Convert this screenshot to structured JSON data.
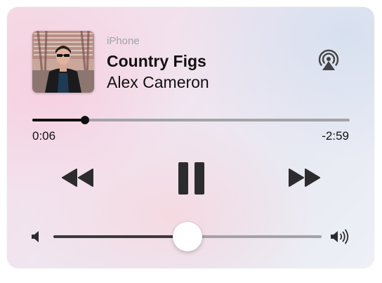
{
  "now_playing": {
    "source": "iPhone",
    "title": "Country Figs",
    "artist": "Alex Cameron",
    "artwork_icon": "album-artwork"
  },
  "playback": {
    "elapsed": "0:06",
    "remaining": "-2:59",
    "progress": 0.167
  },
  "controls": {
    "rewind_icon": "rewind-icon",
    "pause_icon": "pause-icon",
    "forward_icon": "fast-forward-icon",
    "airplay_icon": "airplay-icon"
  },
  "volume": {
    "level": 0.5,
    "low_icon": "volume-low-icon",
    "high_icon": "volume-high-icon"
  },
  "colors": {
    "text": "#111111",
    "source_text": "#a2a2a8",
    "track": "#a3a3a8"
  }
}
